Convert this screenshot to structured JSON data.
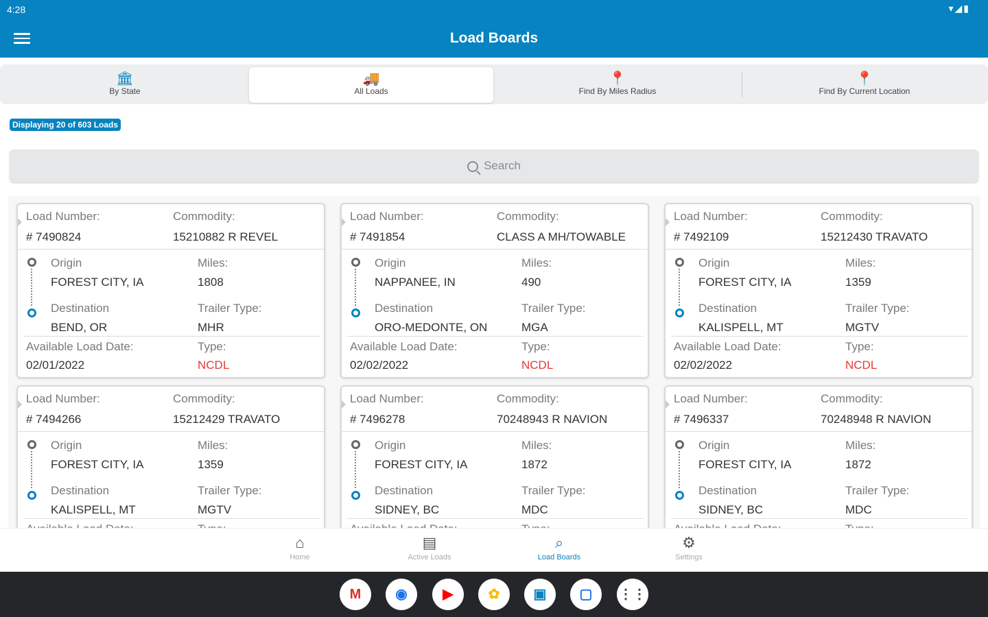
{
  "status": {
    "time": "4:28",
    "icons": "▾◢▮"
  },
  "appbar": {
    "title": "Load Boards"
  },
  "tabs": [
    {
      "label": "By State",
      "icon": "bank-icon",
      "glyph": "🏛"
    },
    {
      "label": "All Loads",
      "icon": "truck-icon",
      "glyph": "🚚"
    },
    {
      "label": "Find By Miles Radius",
      "icon": "map-pin-icon",
      "glyph": "📍"
    },
    {
      "label": "Find By Current Location",
      "icon": "map-pin-icon",
      "glyph": "📍"
    }
  ],
  "badge": "Displaying 20 of 603 Loads",
  "search": {
    "placeholder": "Search"
  },
  "labels": {
    "load_number": "Load Number:",
    "commodity": "Commodity:",
    "origin": "Origin",
    "miles": "Miles:",
    "destination": "Destination",
    "trailer_type": "Trailer Type:",
    "available_date": "Available Load Date:",
    "type": "Type:"
  },
  "cards": [
    {
      "load_number": "# 7490824",
      "commodity": "15210882 R REVEL",
      "origin": "FOREST CITY, IA",
      "miles": "1808",
      "destination": "BEND, OR",
      "trailer_type": "MHR",
      "date": "02/01/2022",
      "type": "NCDL"
    },
    {
      "load_number": "# 7491854",
      "commodity": "CLASS A MH/TOWABLE",
      "origin": "NAPPANEE, IN",
      "miles": "490",
      "destination": "ORO-MEDONTE, ON",
      "trailer_type": "MGA",
      "date": "02/02/2022",
      "type": "NCDL"
    },
    {
      "load_number": "# 7492109",
      "commodity": "15212430 TRAVATO",
      "origin": "FOREST CITY, IA",
      "miles": "1359",
      "destination": "KALISPELL, MT",
      "trailer_type": "MGTV",
      "date": "02/02/2022",
      "type": "NCDL"
    },
    {
      "load_number": "# 7494266",
      "commodity": "15212429 TRAVATO",
      "origin": "FOREST CITY, IA",
      "miles": "1359",
      "destination": "KALISPELL, MT",
      "trailer_type": "MGTV",
      "date": "",
      "type": ""
    },
    {
      "load_number": "# 7496278",
      "commodity": "70248943 R NAVION",
      "origin": "FOREST CITY, IA",
      "miles": "1872",
      "destination": "SIDNEY, BC",
      "trailer_type": "MDC",
      "date": "",
      "type": ""
    },
    {
      "load_number": "# 7496337",
      "commodity": "70248948 R NAVION",
      "origin": "FOREST CITY, IA",
      "miles": "1872",
      "destination": "SIDNEY, BC",
      "trailer_type": "MDC",
      "date": "",
      "type": ""
    }
  ],
  "bottom_nav": [
    {
      "label": "Home",
      "icon": "home-icon",
      "glyph": "⌂"
    },
    {
      "label": "Active Loads",
      "icon": "book-icon",
      "glyph": "▤"
    },
    {
      "label": "Load Boards",
      "icon": "search-icon",
      "glyph": "⌕"
    },
    {
      "label": "Settings",
      "icon": "gear-icon",
      "glyph": "⚙"
    }
  ],
  "dock": [
    {
      "name": "gmail-app-icon",
      "glyph": "M",
      "color": "#d93025"
    },
    {
      "name": "chrome-app-icon",
      "glyph": "◉",
      "color": "#1a73e8"
    },
    {
      "name": "youtube-app-icon",
      "glyph": "▶",
      "color": "#ff0000"
    },
    {
      "name": "photos-app-icon",
      "glyph": "✿",
      "color": "#fbbc04"
    },
    {
      "name": "load-app-icon",
      "glyph": "▣",
      "color": "#0683c0"
    },
    {
      "name": "messages-app-icon",
      "glyph": "▢",
      "color": "#1a73e8"
    },
    {
      "name": "app-drawer-icon",
      "glyph": "⋮⋮",
      "color": "#444444"
    }
  ],
  "colors": {
    "primary": "#0683c0",
    "alert": "#e53935"
  }
}
